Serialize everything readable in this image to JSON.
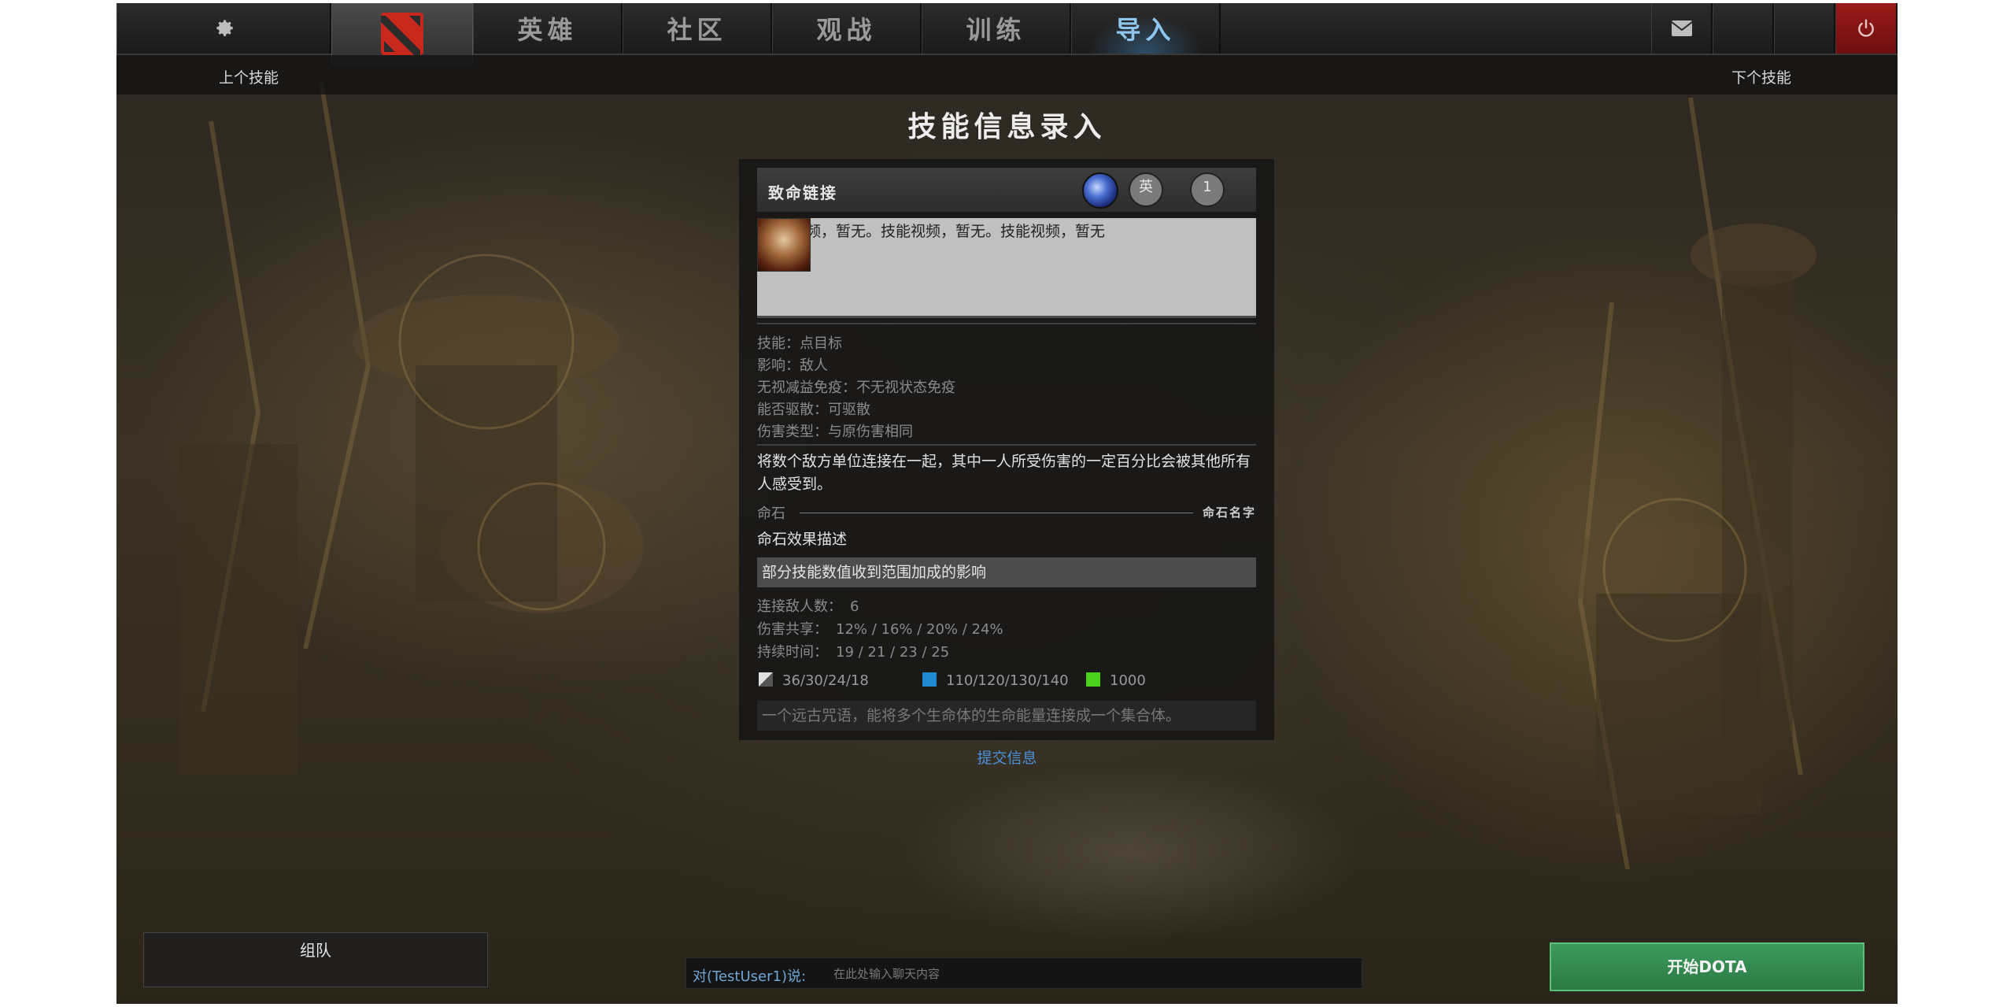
{
  "nav": {
    "tabs": [
      "英雄",
      "社区",
      "观战",
      "训练",
      "导入"
    ],
    "active_tab": "导入",
    "settings_icon": "gear-icon",
    "logo_icon": "dota-logo-icon",
    "mail_icon": "mail-icon",
    "power_icon": "power-icon"
  },
  "subbar": {
    "prev_skill": "上个技能",
    "next_skill": "下个技能"
  },
  "page_title": "技能信息录入",
  "skill": {
    "name": "致命链接",
    "lang_button": "英",
    "level_button": "1",
    "video_text": "频，暂无。技能视频，暂无。技能视频，暂无",
    "attributes": [
      {
        "label": "技能：",
        "value": "点目标"
      },
      {
        "label": "影响：",
        "value": "敌人"
      },
      {
        "label": "无视减益免疫：",
        "value": "不无视状态免疫"
      },
      {
        "label": "能否驱散：",
        "value": "可驱散"
      },
      {
        "label": "伤害类型：",
        "value": "与原伤害相同"
      }
    ],
    "description": "将数个敌方单位连接在一起，其中一人所受伤害的一定百分比会被其他所有人感受到。",
    "aghs_label": "命石",
    "aghs_name": "命石名字",
    "aghs_effect": "命石效果描述",
    "aoe_note": "部分技能数值收到范围加成的影响",
    "stats": [
      {
        "label": "连接敌人数：",
        "value": "6"
      },
      {
        "label": "伤害共享：",
        "value": "12% / 16% / 20% / 24%"
      },
      {
        "label": "持续时间：",
        "value": "19 / 21 / 23 / 25"
      }
    ],
    "costs": {
      "cooldown": "36/30/24/18",
      "mana": "110/120/130/140",
      "health": "1000"
    },
    "lore": "一个远古咒语，能将多个生命体的生命能量连接成一个集合体。"
  },
  "submit": "提交信息",
  "party_label": "组队",
  "chat": {
    "target": "对(TestUser1)说:",
    "placeholder": "在此处输入聊天内容"
  },
  "start_button": "开始DOTA",
  "colors": {
    "active_tab": "#8fc6ee",
    "link": "#4a90d9",
    "start_button": "#2f8a4f",
    "power_button": "#8a1515",
    "mana": "#1f8ad1",
    "health": "#4bd11c"
  }
}
